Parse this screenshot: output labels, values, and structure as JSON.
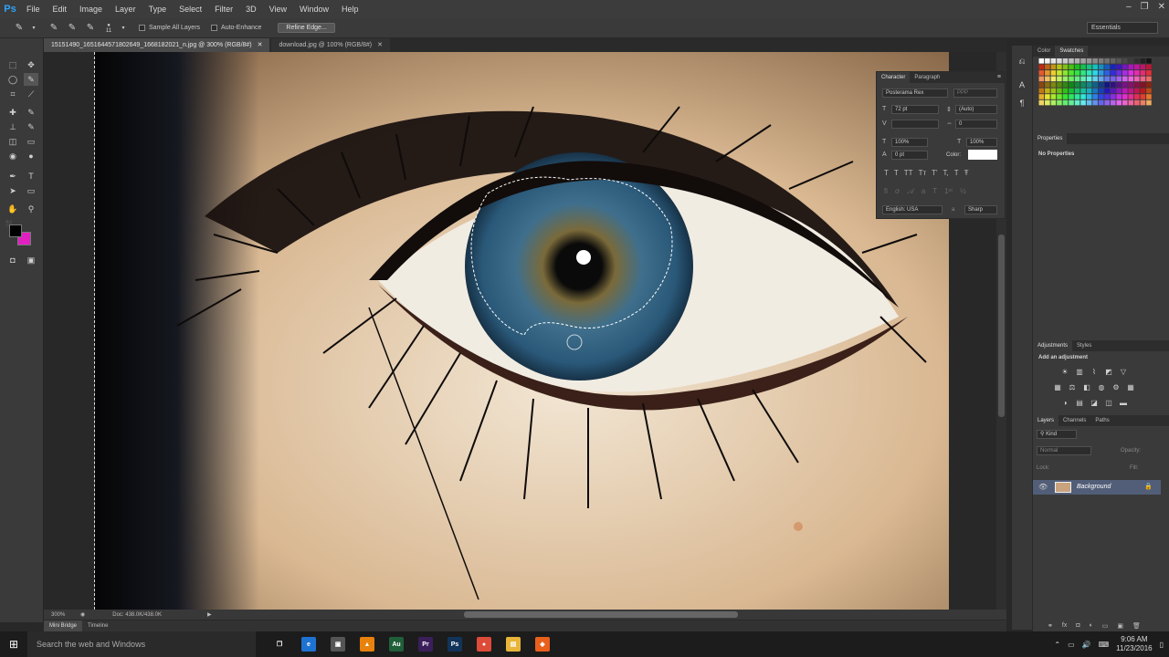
{
  "app": {
    "logo": "Ps"
  },
  "menu": [
    "File",
    "Edit",
    "Image",
    "Layer",
    "Type",
    "Select",
    "Filter",
    "3D",
    "View",
    "Window",
    "Help"
  ],
  "window_controls": {
    "minimize": "–",
    "restore": "❐",
    "close": "✕"
  },
  "options_bar": {
    "brush_size": "11",
    "sample_all_layers": "Sample All Layers",
    "auto_enhance": "Auto-Enhance",
    "refine_edge": "Refine Edge...",
    "workspace": "Essentials"
  },
  "doc_tabs": [
    {
      "label": "15151490_1651644571802649_1668182021_n.jpg @ 300% (RGB/8#)",
      "active": true
    },
    {
      "label": "download.jpg @ 100% (RGB/8#)",
      "active": false
    }
  ],
  "status": {
    "zoom": "300%",
    "doc": "Doc: 438.0K/438.0K"
  },
  "bottom_tabs": [
    {
      "label": "Mini Bridge",
      "active": true
    },
    {
      "label": "Timeline",
      "active": false
    }
  ],
  "character_panel": {
    "tabs": [
      "Character",
      "Paragraph"
    ],
    "font": "Posterama Rex",
    "style": "PPP",
    "size": "72 pt",
    "leading": "(Auto)",
    "kerning": "",
    "tracking": "0",
    "vscale": "100%",
    "hscale": "100%",
    "baseline": "0 pt",
    "color_label": "Color:",
    "language": "English: USA",
    "aa_label": "a",
    "antialias": "Sharp"
  },
  "swatches_panel": {
    "tabs": [
      "Color",
      "Swatches"
    ]
  },
  "properties_panel": {
    "tab": "Properties",
    "text": "No Properties"
  },
  "adjustments_panel": {
    "tabs": [
      "Adjustments",
      "Styles"
    ],
    "heading": "Add an adjustment"
  },
  "layers_panel": {
    "tabs": [
      "Layers",
      "Channels",
      "Paths"
    ],
    "filter": "Kind",
    "blend_mode": "Normal",
    "opacity_label": "Opacity:",
    "lock_label": "Lock:",
    "fill_label": "Fill:",
    "layer_name": "Background"
  },
  "taskbar": {
    "search_placeholder": "Search the web and Windows",
    "apps": [
      {
        "name": "task-view",
        "glyph": "❐",
        "color": "transparent"
      },
      {
        "name": "edge",
        "glyph": "e",
        "color": "#1e73d2"
      },
      {
        "name": "store",
        "glyph": "▣",
        "color": "#555555"
      },
      {
        "name": "vlc",
        "glyph": "▲",
        "color": "#e8820c"
      },
      {
        "name": "audition",
        "glyph": "Au",
        "color": "#1f5f3a"
      },
      {
        "name": "premiere",
        "glyph": "Pr",
        "color": "#3b1f5b"
      },
      {
        "name": "photoshop",
        "glyph": "Ps",
        "color": "#12345a"
      },
      {
        "name": "chrome",
        "glyph": "●",
        "color": "#dd4b39"
      },
      {
        "name": "explorer",
        "glyph": "▤",
        "color": "#e8b53a"
      },
      {
        "name": "app-orange",
        "glyph": "◆",
        "color": "#e8601c"
      }
    ],
    "time": "9:06 AM",
    "date": "11/23/2016"
  },
  "colors": {
    "foreground": "#000000",
    "background": "#e020c0",
    "accent": "#2fa3f7"
  }
}
